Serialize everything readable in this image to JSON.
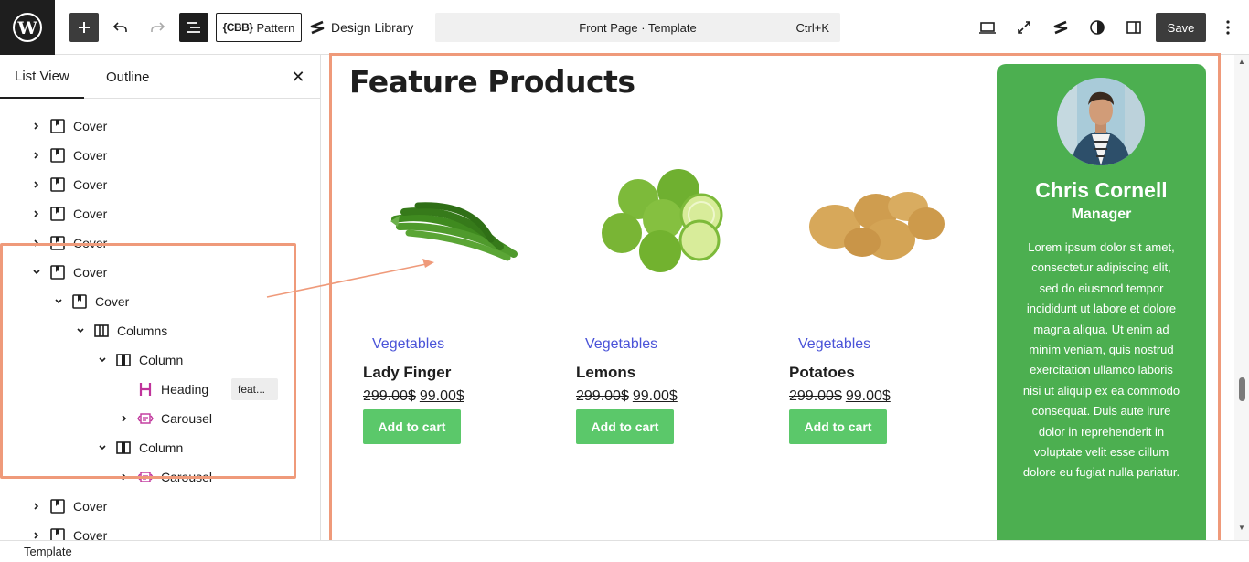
{
  "toolbar": {
    "pattern_label": "Pattern",
    "pattern_prefix": "{CBB}",
    "design_library_label": "Design Library",
    "command_title": "Front Page · Template",
    "command_shortcut": "Ctrl+K",
    "save_label": "Save"
  },
  "sidebar": {
    "tab_list_view": "List View",
    "tab_outline": "Outline",
    "rows": [
      {
        "label": "Cover"
      },
      {
        "label": "Cover"
      },
      {
        "label": "Cover"
      },
      {
        "label": "Cover"
      },
      {
        "label": "Cover"
      },
      {
        "label": "Cover"
      },
      {
        "label": "Cover"
      },
      {
        "label": "Columns"
      },
      {
        "label": "Column"
      },
      {
        "label": "Heading",
        "anchor": "feat..."
      },
      {
        "label": "Carousel"
      },
      {
        "label": "Column"
      },
      {
        "label": "Carousel"
      },
      {
        "label": "Cover"
      },
      {
        "label": "Cover"
      }
    ]
  },
  "canvas": {
    "title": "Feature Products",
    "products": [
      {
        "category": "Vegetables",
        "name": "Lady Finger",
        "old_price": "299.00$",
        "new_price": "99.00$",
        "cart": "Add to cart"
      },
      {
        "category": "Vegetables",
        "name": "Lemons",
        "old_price": "299.00$",
        "new_price": "99.00$",
        "cart": "Add to cart"
      },
      {
        "category": "Vegetables",
        "name": "Potatoes",
        "old_price": "299.00$",
        "new_price": "99.00$",
        "cart": "Add to cart"
      }
    ],
    "profile": {
      "name": "Chris Cornell",
      "role": "Manager",
      "bio": "Lorem ipsum dolor sit amet, consectetur adipiscing elit, sed do eiusmod tempor incididunt ut labore et dolore magna aliqua. Ut enim ad minim veniam, quis nostrud exercitation ullamco laboris nisi ut aliquip ex ea commodo consequat. Duis aute irure dolor in reprehenderit in voluptate velit esse cillum dolore eu fugiat nulla pariatur."
    }
  },
  "footer": {
    "breadcrumb": "Template"
  },
  "colors": {
    "accent_highlight": "#ef9a7a",
    "profile_bg": "#4caf50",
    "cart_bg": "#5bc86a",
    "category": "#4a53d8"
  }
}
